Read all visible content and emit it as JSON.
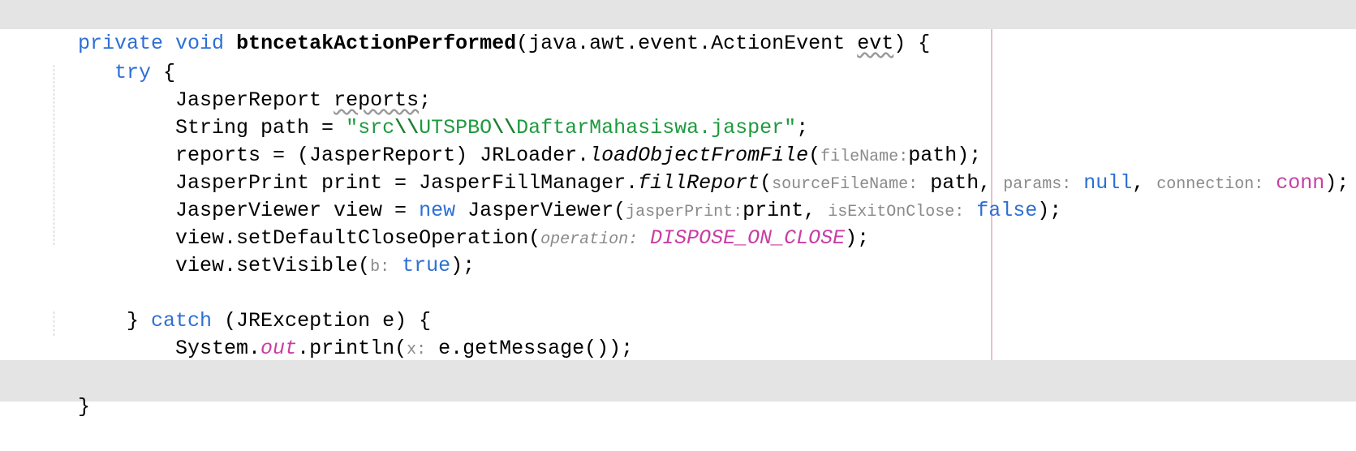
{
  "code": {
    "l1": {
      "mod": "private void",
      "name": "btncetakActionPerformed",
      "open": "(java.awt.event.ActionEvent ",
      "param": "evt",
      "close": ") {"
    },
    "l2": {
      "kw": "try",
      "rest": " {"
    },
    "l3": {
      "type": "JasperReport ",
      "var": "reports",
      "end": ";"
    },
    "l4": {
      "pre": "String path = ",
      "q1": "\"src",
      "e1": "\\\\",
      "mid": "UTSPBO",
      "e2": "\\\\",
      "q2": "DaftarMahasiswa.jasper\"",
      "end": ";"
    },
    "l5": {
      "pre": "reports = (JasperReport) JRLoader.",
      "method": "loadObjectFromFile",
      "open": "(",
      "hint": "fileName:",
      "arg": "path",
      "end": ");"
    },
    "l6": {
      "pre": "JasperPrint print = JasperFillManager.",
      "method": "fillReport",
      "open": "(",
      "hint1": "sourceFileName:",
      "arg1": " path, ",
      "hint2": "params:",
      "arg2": " null",
      "sep": ", ",
      "hint3": "connection:",
      "arg3": " conn",
      "end": ");"
    },
    "l7": {
      "pre": "JasperViewer view = ",
      "kw": "new",
      "mid": " JasperViewer(",
      "hint1": "jasperPrint:",
      "arg1": "print, ",
      "hint2": "isExitOnClose:",
      "arg2": " false",
      "end": ");"
    },
    "l8": {
      "pre": "view.setDefaultCloseOperation(",
      "hint": "operation:",
      "arg": " DISPOSE_ON_CLOSE",
      "end": ");"
    },
    "l9": {
      "pre": "view.setVisible(",
      "hint": "b:",
      "arg": " true",
      "end": ");"
    },
    "l11": {
      "pre": "} ",
      "kw": "catch",
      "rest": " (JRException e) {"
    },
    "l12": {
      "pre": "System.",
      "field": "out",
      "mid": ".println(",
      "hint": "x:",
      "arg": " e.getMessage());"
    },
    "l13": {
      "text": "}"
    },
    "l14": {
      "text": "}"
    }
  }
}
